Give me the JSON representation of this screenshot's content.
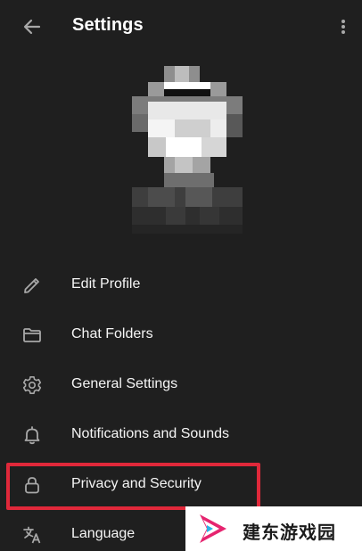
{
  "header": {
    "title": "Settings",
    "back_icon": "arrow-left-icon",
    "more_icon": "more-vertical-icon"
  },
  "avatar": {
    "state": "pixelated"
  },
  "menu": {
    "items": [
      {
        "label": "Edit Profile",
        "icon": "pencil-icon"
      },
      {
        "label": "Chat Folders",
        "icon": "folder-icon"
      },
      {
        "label": "General Settings",
        "icon": "gear-icon"
      },
      {
        "label": "Notifications and Sounds",
        "icon": "bell-icon"
      },
      {
        "label": "Privacy and Security",
        "icon": "lock-icon",
        "highlighted": true
      },
      {
        "label": "Language",
        "icon": "translate-icon"
      }
    ]
  },
  "colors": {
    "background": "#1f1f1f",
    "text": "#ffffff",
    "icon": "#a8a8a8",
    "highlight": "#e0283a"
  },
  "watermark": {
    "text": "建东游戏园"
  }
}
